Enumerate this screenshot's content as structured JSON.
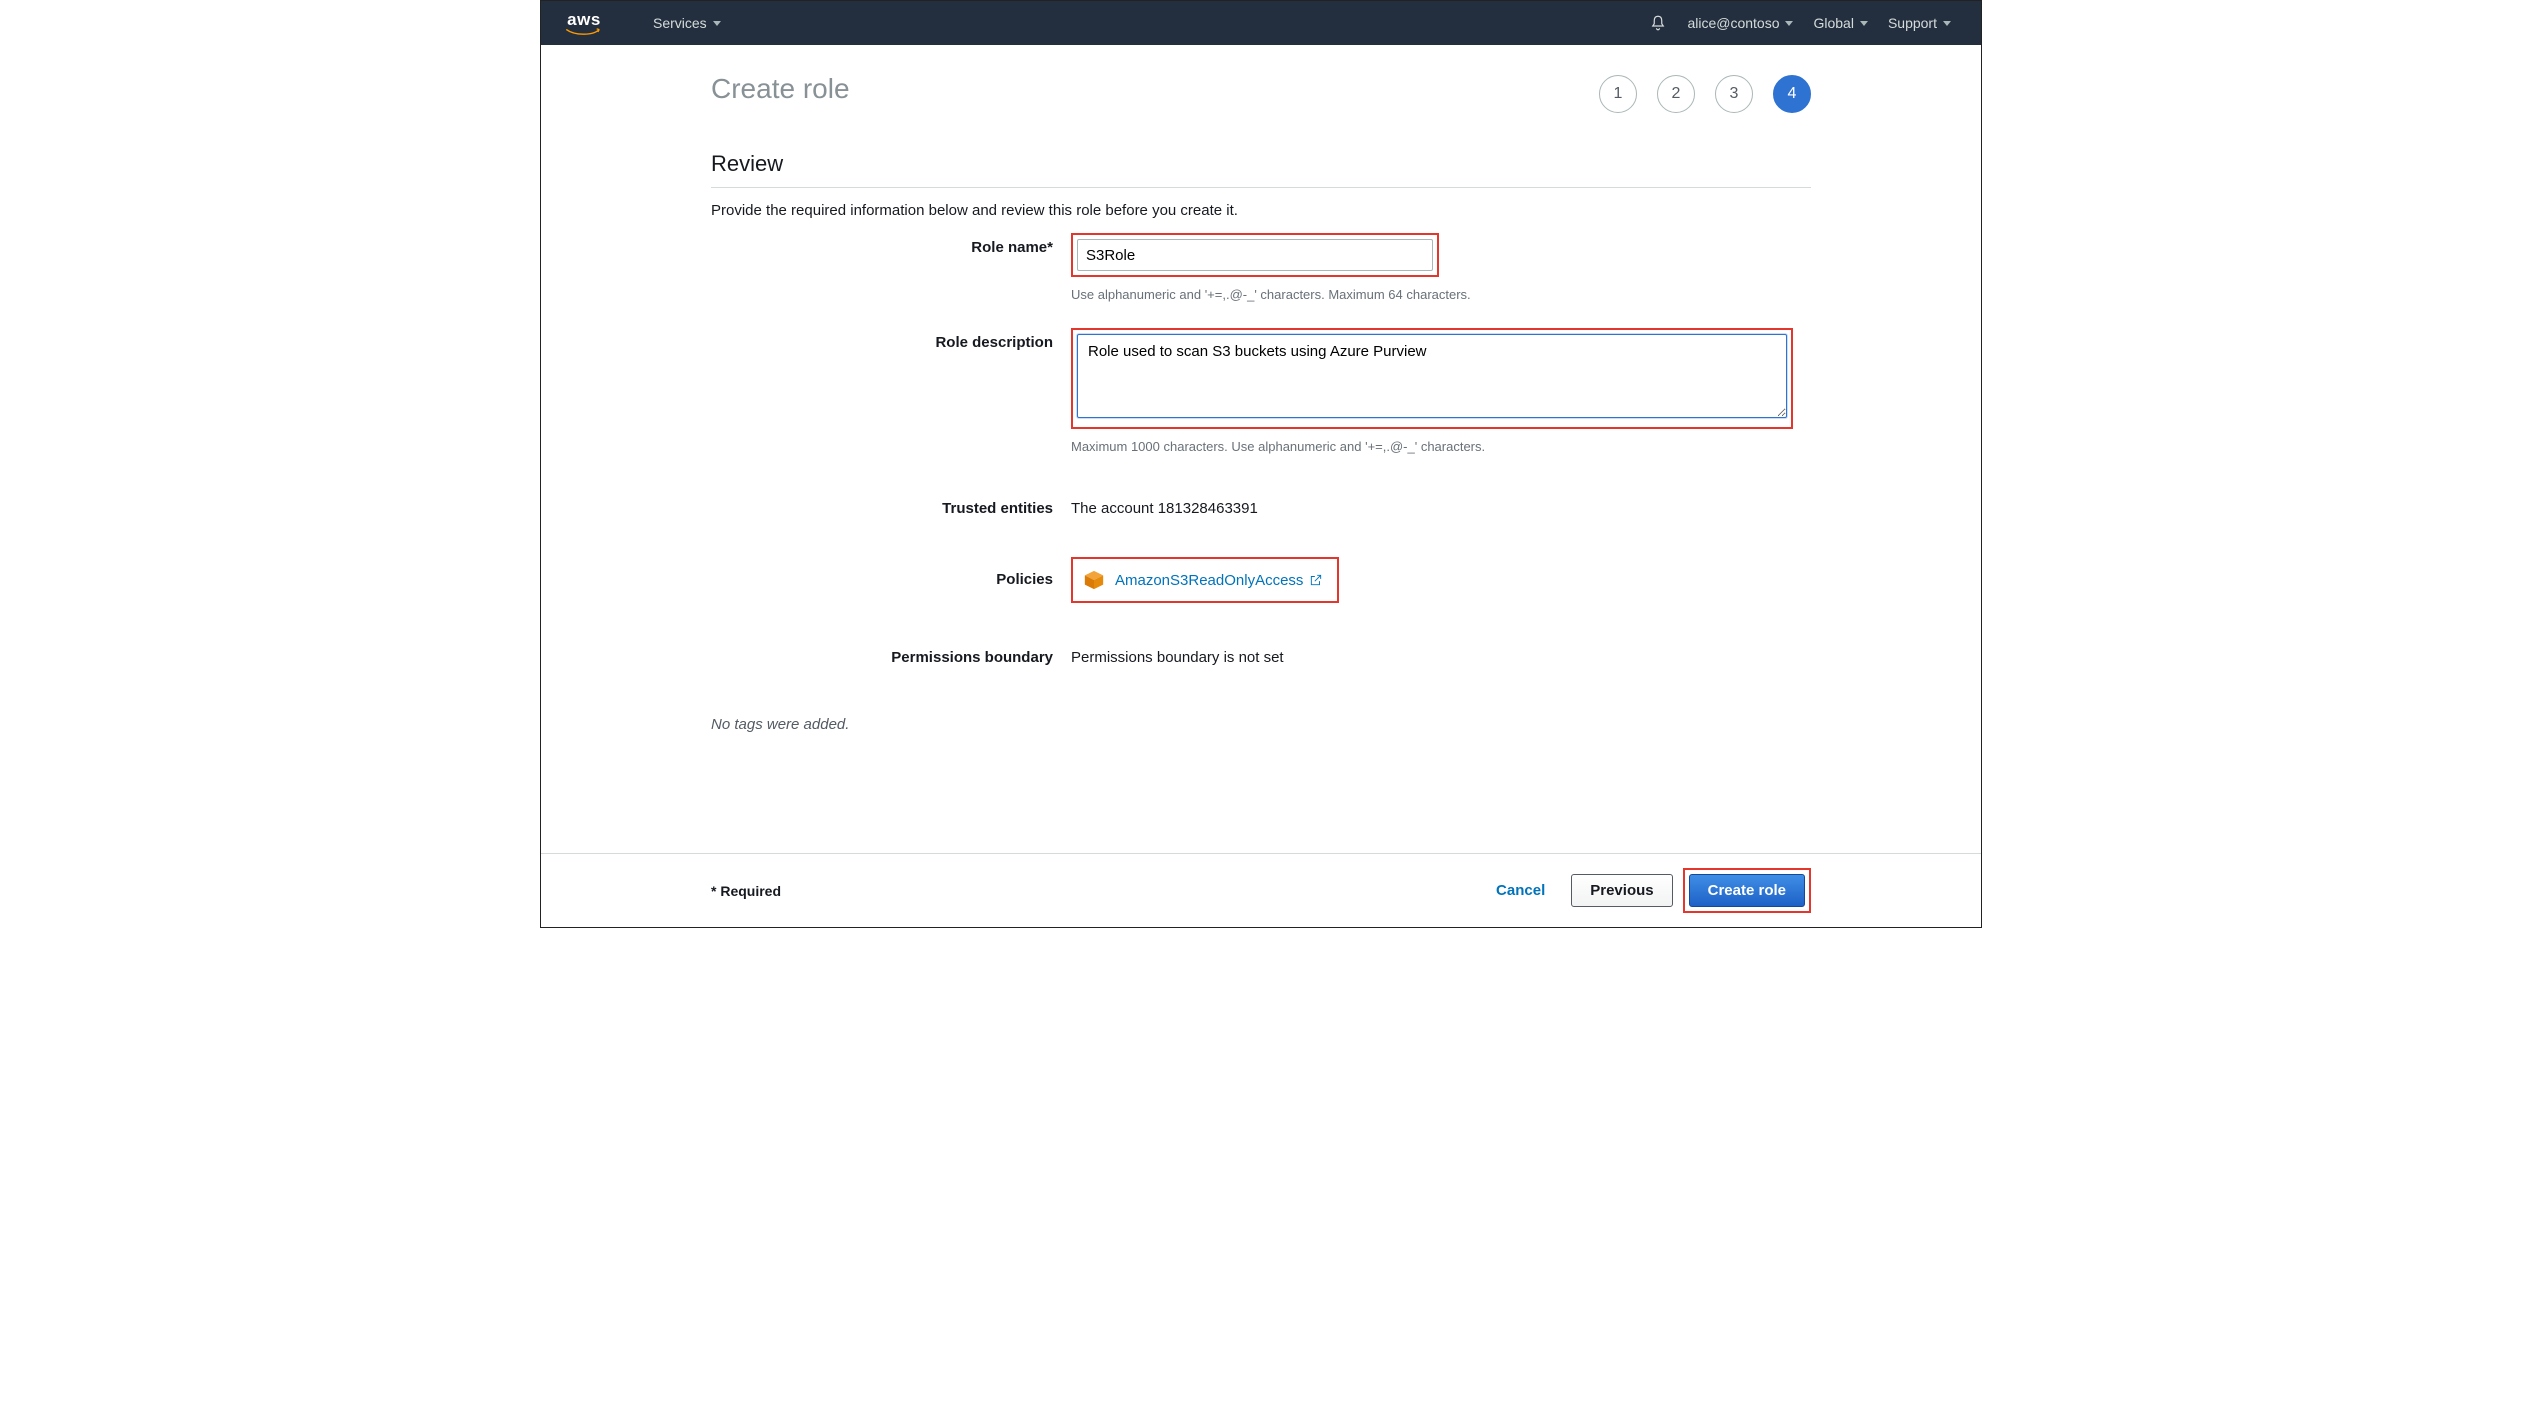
{
  "nav": {
    "services_label": "Services",
    "account_label": "alice@contoso",
    "region_label": "Global",
    "support_label": "Support"
  },
  "page_title": "Create role",
  "steps": [
    "1",
    "2",
    "3",
    "4"
  ],
  "active_step_index": 3,
  "section": {
    "title": "Review",
    "subtitle": "Provide the required information below and review this role before you create it."
  },
  "form": {
    "role_name_label": "Role name*",
    "role_name_value": "S3Role",
    "role_name_hint": "Use alphanumeric and '+=,.@-_' characters. Maximum 64 characters.",
    "role_desc_label": "Role description",
    "role_desc_value": "Role used to scan S3 buckets using Azure Purview",
    "role_desc_hint": "Maximum 1000 characters. Use alphanumeric and '+=,.@-_' characters.",
    "trusted_entities_label": "Trusted entities",
    "trusted_entities_value": "The account 181328463391",
    "policies_label": "Policies",
    "policy_name": "AmazonS3ReadOnlyAccess",
    "permissions_boundary_label": "Permissions boundary",
    "permissions_boundary_value": "Permissions boundary is not set"
  },
  "no_tags_text": "No tags were added.",
  "footer": {
    "required_note": "* Required",
    "cancel": "Cancel",
    "previous": "Previous",
    "create": "Create role"
  }
}
